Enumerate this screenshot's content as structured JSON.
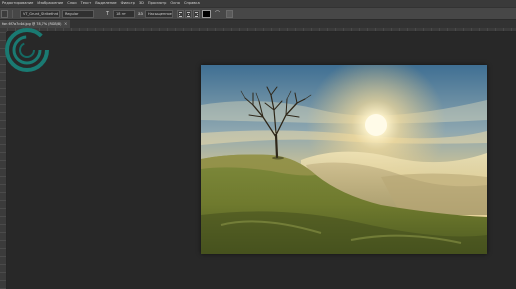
{
  "menu": {
    "items": [
      "Редактирование",
      "Изображение",
      "Слои",
      "Текст",
      "Выделение",
      "Фильтр",
      "3D",
      "Просмотр",
      "Окно",
      "Справка"
    ]
  },
  "options": {
    "font_family": "VT_Grunt_Strikethrd",
    "font_style": "Regular",
    "font_size": "18 пт",
    "antialias_label": "aa",
    "antialias_value": "Насыщенное",
    "size_icon": "font-size-icon",
    "text_color": "#000000"
  },
  "document": {
    "tab_label": "fon 6f7a7c4d.jpg @ 78,7% (RGB/8)",
    "tab_close": "×"
  },
  "canvas": {
    "image_description": "sunrise-tree-hill-photo"
  },
  "colors": {
    "workspace": "#282828",
    "spinner": "#1a7a72"
  }
}
